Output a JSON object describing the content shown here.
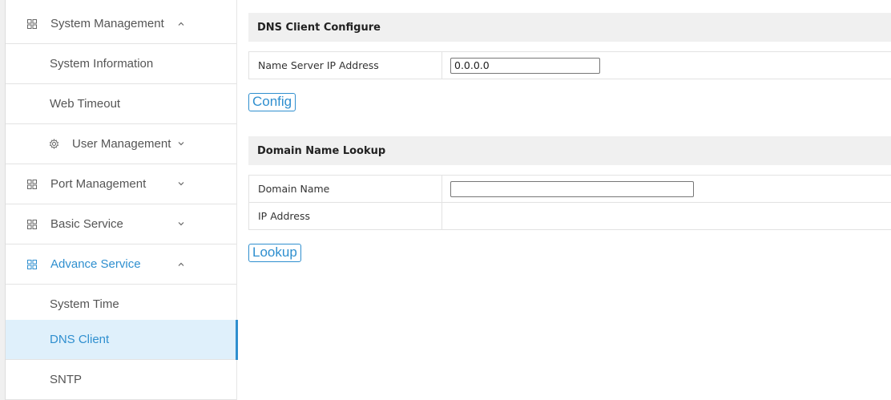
{
  "sidebar": {
    "items": [
      {
        "label": "System Management",
        "icon": "grid-icon",
        "chevron": "up"
      },
      {
        "label": "System Information"
      },
      {
        "label": "Web Timeout"
      },
      {
        "label": "User Management",
        "icon": "gear-icon",
        "chevron": "down"
      },
      {
        "label": "Port Management",
        "icon": "grid-icon",
        "chevron": "down"
      },
      {
        "label": "Basic Service",
        "icon": "grid-icon",
        "chevron": "down"
      },
      {
        "label": "Advance Service",
        "icon": "grid-icon",
        "chevron": "up"
      },
      {
        "label": "System Time"
      },
      {
        "label": "DNS Client"
      },
      {
        "label": "SNTP"
      }
    ]
  },
  "dns_config": {
    "title": "DNS Client Configure",
    "name_server_label": "Name Server IP Address",
    "name_server_value": "0.0.0.0",
    "config_button": "Config"
  },
  "lookup": {
    "title": "Domain Name Lookup",
    "domain_name_label": "Domain Name",
    "domain_name_value": "",
    "ip_address_label": "IP Address",
    "ip_address_value": "",
    "lookup_button": "Lookup"
  },
  "colors": {
    "accent": "#2f8fcf",
    "active_bg": "#dff0fb",
    "header_bg": "#f0f0f0"
  }
}
